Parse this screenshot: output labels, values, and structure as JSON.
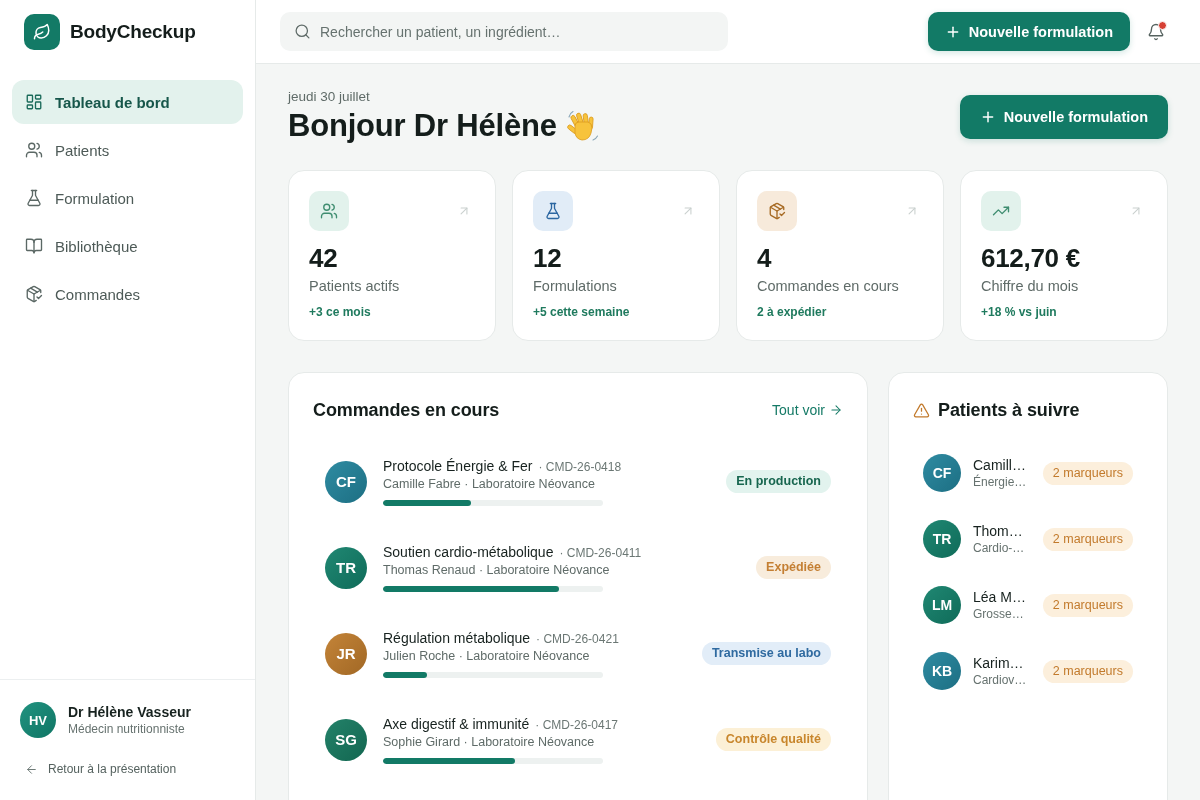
{
  "sidebar": {
    "brand": "BodyCheckup",
    "items": [
      {
        "label": "Tableau de bord",
        "selected": true
      },
      {
        "label": "Patients",
        "selected": false
      },
      {
        "label": "Formulation",
        "selected": false
      },
      {
        "label": "Bibliothèque",
        "selected": false
      },
      {
        "label": "Commandes",
        "selected": false
      }
    ],
    "user": {
      "initials": "HV",
      "name": "Dr Hélène Vasseur",
      "role": "Médecin nutritionniste",
      "color": "#138c78"
    },
    "back_link": "Retour à la présentation"
  },
  "topbar": {
    "search": {
      "placeholder": "Rechercher un patient, un ingrédient…"
    },
    "button": "Nouvelle formulation",
    "notifications": {
      "unread": true
    }
  },
  "header": {
    "date": "jeudi 30 juillet",
    "greeting": "Bonjour Dr Hélène",
    "button": "Nouvelle formulation"
  },
  "stats": [
    {
      "value": "42",
      "label": "Patients actifs",
      "trend": "+3 ce mois",
      "color": "#e2f2ec"
    },
    {
      "value": "12",
      "label": "Formulations",
      "trend": "+5 cette semaine",
      "color": "#e1ecf7"
    },
    {
      "value": "4",
      "label": "Commandes en cours",
      "trend": "2 à expédier",
      "color": "#f7eadb"
    },
    {
      "value": "612,70 €",
      "label": "Chiffre du mois",
      "trend": "+18 % vs juin",
      "color": "#e2f2ec"
    }
  ],
  "orders": {
    "title": "Commandes en cours",
    "link": "Tout voir",
    "rows": [
      {
        "initials": "CF",
        "color": "#22849c",
        "title": "Protocole Énergie & Fer",
        "ref": "· CMD-26-0418",
        "subtitle": "Camille Fabre · Laboratoire Néovance",
        "level": 0.4,
        "status": {
          "label": "En production",
          "kind": "production"
        }
      },
      {
        "initials": "TR",
        "color": "#12806a",
        "title": "Soutien cardio-métabolique",
        "ref": "· CMD-26-0411",
        "subtitle": "Thomas Renaud · Laboratoire Néovance",
        "level": 0.8,
        "status": {
          "label": "Expédiée",
          "kind": "shipped"
        }
      },
      {
        "initials": "JR",
        "color": "#c07c2c",
        "title": "Régulation métabolique",
        "ref": "· CMD-26-0421",
        "subtitle": "Julien Roche · Laboratoire Néovance",
        "level": 0.2,
        "status": {
          "label": "Transmise au labo",
          "kind": "transmitted"
        }
      },
      {
        "initials": "SG",
        "color": "#167a60",
        "title": "Axe digestif & immunité",
        "ref": "· CMD-26-0417",
        "subtitle": "Sophie Girard · Laboratoire Néovance",
        "level": 0.6,
        "status": {
          "label": "Contrôle qualité",
          "kind": "quality"
        }
      }
    ]
  },
  "follow_up": {
    "title": "Patients à suivre",
    "rows": [
      {
        "initials": "CF",
        "color": "#22849c",
        "name": "Camill…",
        "detail": "Énergie…",
        "badge": "2 marqueurs"
      },
      {
        "initials": "TR",
        "color": "#12806a",
        "name": "Thom…",
        "detail": "Cardio-…",
        "badge": "2 marqueurs"
      },
      {
        "initials": "LM",
        "color": "#12806a",
        "name": "Léa M…",
        "detail": "Grosse…",
        "badge": "2 marqueurs"
      },
      {
        "initials": "KB",
        "color": "#22849c",
        "name": "Karim…",
        "detail": "Cardiov…",
        "badge": "2 marqueurs"
      }
    ]
  }
}
